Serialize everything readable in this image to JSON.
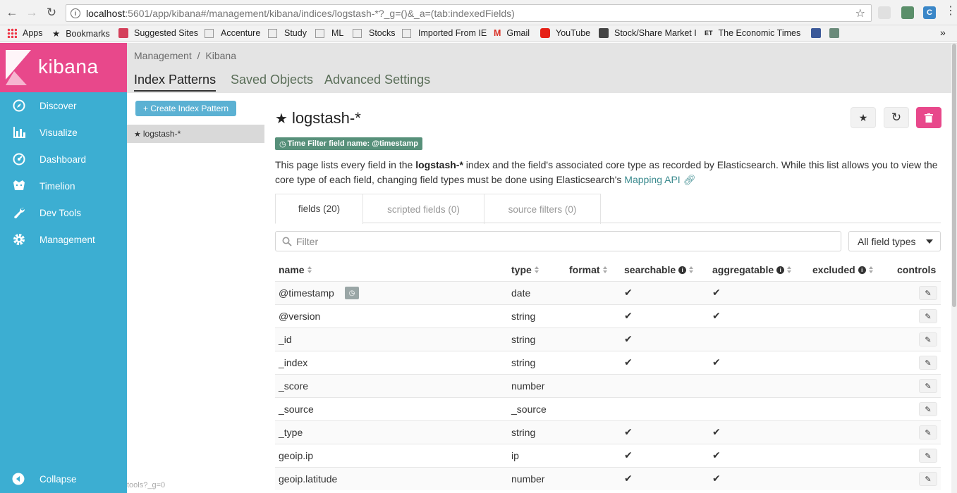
{
  "browser": {
    "url_host": "localhost",
    "url_path": ":5601/app/kibana#/management/kibana/indices/logstash-*?_g=()&_a=(tab:indexedFields)",
    "bookmarks": [
      {
        "label": "Apps"
      },
      {
        "label": "Bookmarks"
      },
      {
        "label": "Suggested Sites"
      },
      {
        "label": "Accenture"
      },
      {
        "label": "Study"
      },
      {
        "label": "ML"
      },
      {
        "label": "Stocks"
      },
      {
        "label": "Imported From IE"
      },
      {
        "label": "Gmail"
      },
      {
        "label": "YouTube"
      },
      {
        "label": "Stock/Share Market I"
      },
      {
        "label": "The Economic Times"
      }
    ],
    "more": "»"
  },
  "sidebar": {
    "brand": "kibana",
    "items": [
      {
        "label": "Discover",
        "icon": "compass-icon"
      },
      {
        "label": "Visualize",
        "icon": "bar-chart-icon"
      },
      {
        "label": "Dashboard",
        "icon": "dashboard-icon"
      },
      {
        "label": "Timelion",
        "icon": "timelion-icon"
      },
      {
        "label": "Dev Tools",
        "icon": "wrench-icon"
      },
      {
        "label": "Management",
        "icon": "gear-icon"
      }
    ],
    "collapse_label": "Collapse"
  },
  "header": {
    "breadcrumb": [
      "Management",
      "/",
      "Kibana"
    ],
    "tabs": [
      {
        "label": "Index Patterns",
        "active": true
      },
      {
        "label": "Saved Objects",
        "active": false
      },
      {
        "label": "Advanced Settings",
        "active": false
      }
    ]
  },
  "index_list": {
    "create_label": "+ Create Index Pattern",
    "items": [
      {
        "label": "logstash-*"
      }
    ]
  },
  "detail": {
    "title": "logstash-*",
    "time_filter_badge": "Time Filter field name: @timestamp",
    "description_part1": "This page lists every field in the ",
    "description_bold": "logstash-*",
    "description_part2": " index and the field's associated core type as recorded by Elasticsearch. While this list allows you to view the core type of each field, changing field types must be done using Elasticsearch's ",
    "description_link": "Mapping API",
    "tabs": [
      {
        "label": "fields (20)",
        "active": true
      },
      {
        "label": "scripted fields (0)",
        "active": false
      },
      {
        "label": "source filters (0)",
        "active": false
      }
    ],
    "filter_placeholder": "Filter",
    "type_select": "All field types",
    "columns": [
      "name",
      "type",
      "format",
      "searchable",
      "aggregatable",
      "excluded",
      "controls"
    ],
    "rows": [
      {
        "name": "@timestamp",
        "type": "date",
        "searchable": true,
        "aggregatable": true,
        "time_field": true
      },
      {
        "name": "@version",
        "type": "string",
        "searchable": true,
        "aggregatable": true
      },
      {
        "name": "_id",
        "type": "string",
        "searchable": true,
        "aggregatable": false
      },
      {
        "name": "_index",
        "type": "string",
        "searchable": true,
        "aggregatable": true
      },
      {
        "name": "_score",
        "type": "number",
        "searchable": false,
        "aggregatable": false
      },
      {
        "name": "_source",
        "type": "_source",
        "searchable": false,
        "aggregatable": false
      },
      {
        "name": "_type",
        "type": "string",
        "searchable": true,
        "aggregatable": true
      },
      {
        "name": "geoip.ip",
        "type": "ip",
        "searchable": true,
        "aggregatable": true
      },
      {
        "name": "geoip.latitude",
        "type": "number",
        "searchable": true,
        "aggregatable": true
      }
    ]
  },
  "status_text": "tools?_g=0",
  "colors": {
    "sidebar": "#3caed2",
    "brand": "#e8488b",
    "delete_button": "#e8488b",
    "badge": "#57907a"
  }
}
